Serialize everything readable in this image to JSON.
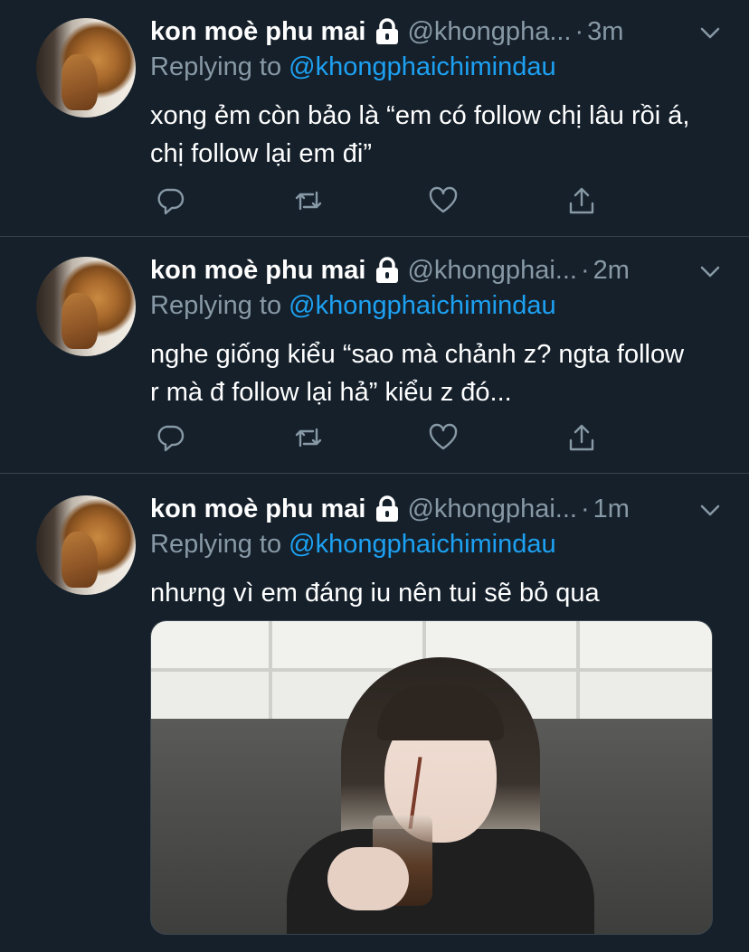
{
  "colors": {
    "background": "#15202b",
    "divider": "#38444d",
    "secondary_text": "#8899a6",
    "mention": "#1da1f2",
    "primary_text": "#ffffff"
  },
  "tweets": [
    {
      "name": "kon moè phu mai",
      "handle": "@khongpha...",
      "dot": "·",
      "time": "3m",
      "replying_prefix": "Replying to ",
      "replying_to": "@khongphaichimindau",
      "text": "xong ẻm còn bảo là “em có follow chị lâu rồi á, chị follow lại em đi”",
      "icons": [
        "reply-icon",
        "retweet-icon",
        "like-icon",
        "share-icon"
      ]
    },
    {
      "name": "kon moè phu mai",
      "handle": "@khongphai...",
      "dot": "·",
      "time": "2m",
      "replying_prefix": "Replying to ",
      "replying_to": "@khongphaichimindau",
      "text": "nghe giống kiểu “sao mà chảnh z? ngta follow r mà đ follow lại hả” kiểu z đó...",
      "icons": [
        "reply-icon",
        "retweet-icon",
        "like-icon",
        "share-icon"
      ]
    },
    {
      "name": "kon moè phu mai",
      "handle": "@khongphai...",
      "dot": "·",
      "time": "1m",
      "replying_prefix": "Replying to ",
      "replying_to": "@khongphaichimindau",
      "text": "nhưng vì em đáng iu nên tui sẽ bỏ qua"
    }
  ]
}
